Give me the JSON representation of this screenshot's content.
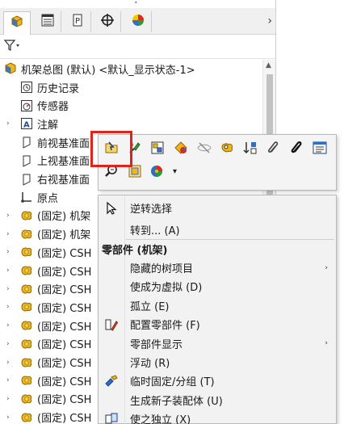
{
  "tabs": [
    {
      "name": "feature-manager",
      "icon": "feature-tree-icon",
      "active": true
    },
    {
      "name": "property-manager",
      "icon": "property-list-icon",
      "active": false
    },
    {
      "name": "configuration-manager",
      "icon": "configuration-icon",
      "active": false
    },
    {
      "name": "dimxpert-manager",
      "icon": "crosshair-icon",
      "active": false
    },
    {
      "name": "display-manager",
      "icon": "appearance-pie-icon",
      "active": false
    }
  ],
  "tree": {
    "root": "机架总图 (默认) <默认_显示状态-1>",
    "items": [
      {
        "label": "历史记录",
        "icon": "history-icon",
        "expander": ""
      },
      {
        "label": "传感器",
        "icon": "sensor-icon",
        "expander": ""
      },
      {
        "label": "注解",
        "icon": "annotation-icon",
        "expander": "›"
      },
      {
        "label": "前视基准面",
        "icon": "plane-icon",
        "expander": ""
      },
      {
        "label": "上视基准面",
        "icon": "plane-icon",
        "expander": ""
      },
      {
        "label": "右视基准面",
        "icon": "plane-icon",
        "expander": ""
      },
      {
        "label": "原点",
        "icon": "origin-icon",
        "expander": ""
      },
      {
        "label": "(固定) 机架",
        "icon": "part-icon",
        "expander": "›"
      },
      {
        "label": "(固定) 机架",
        "icon": "part-icon",
        "expander": "›"
      },
      {
        "label": "(固定) CSH",
        "icon": "part-icon",
        "expander": "›"
      },
      {
        "label": "(固定) CSH",
        "icon": "part-icon",
        "expander": "›"
      },
      {
        "label": "(固定) CSH",
        "icon": "part-icon",
        "expander": "›"
      },
      {
        "label": "(固定) CSH",
        "icon": "part-icon",
        "expander": "›"
      },
      {
        "label": "(固定) CSH",
        "icon": "part-icon",
        "expander": "›"
      },
      {
        "label": "(固定) CSH",
        "icon": "part-icon",
        "expander": "›"
      },
      {
        "label": "(固定) CSH",
        "icon": "part-icon",
        "expander": "›"
      },
      {
        "label": "(固定) CSH",
        "icon": "part-icon",
        "expander": "›"
      },
      {
        "label": "(固定) CSH",
        "icon": "part-icon",
        "expander": "›"
      },
      {
        "label": "(固定) CSH",
        "icon": "part-icon",
        "expander": "›"
      }
    ]
  },
  "toolbar": {
    "row1": [
      "open-part-icon",
      "edit-component-icon",
      "assembly-structure-icon",
      "appearance-icon",
      "hide-icon",
      "show-icon",
      "reorder-icon",
      "paperclip-icon",
      "paperclip-dark-icon",
      "properties-icon"
    ],
    "row2": [
      "zoom-to-selection-icon",
      "view-icon",
      "appearance-dropdown-icon"
    ],
    "row2_dropdown": "▾"
  },
  "menu": {
    "top_items": [
      {
        "label": "逆转选择",
        "icon": "cursor-icon"
      },
      {
        "label": "转到... (A)",
        "icon": ""
      }
    ],
    "section_header": "零部件 (机架)",
    "items": [
      {
        "label": "隐藏的树项目",
        "icon": "",
        "submenu": true
      },
      {
        "label": "使成为虚拟 (D)",
        "icon": "",
        "submenu": false
      },
      {
        "label": "孤立 (E)",
        "icon": "",
        "submenu": false
      },
      {
        "label": "配置零部件 (F)",
        "icon": "pencil-config-icon",
        "submenu": false
      },
      {
        "label": "零部件显示",
        "icon": "",
        "submenu": true
      },
      {
        "label": "浮动 (R)",
        "icon": "",
        "submenu": false
      },
      {
        "label": "临时固定/分组 (T)",
        "icon": "temp-fix-icon",
        "submenu": false
      },
      {
        "label": "生成新子装配体 (U)",
        "icon": "",
        "submenu": false
      },
      {
        "label": "使之独立 (X)",
        "icon": "make-independent-icon",
        "submenu": false
      }
    ],
    "submenu_arrow": "›"
  },
  "chrome": {
    "tab_next": "›",
    "scroll_up": "▲",
    "top_indicator": "•"
  },
  "colors": {
    "highlight_border": "#e2231a",
    "part_icon": "#f2b51c"
  }
}
